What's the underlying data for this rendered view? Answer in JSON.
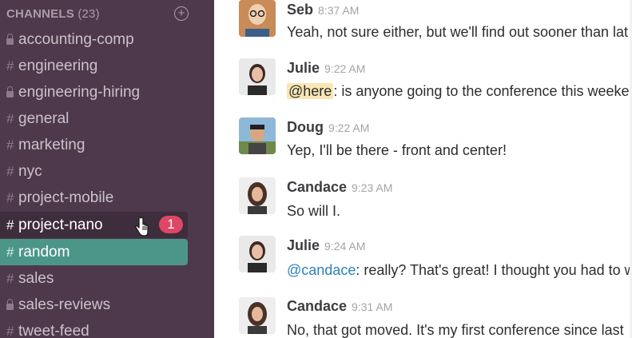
{
  "sidebar": {
    "header": {
      "title": "CHANNELS",
      "count": "(23)",
      "add_symbol": "+"
    },
    "channels": [
      {
        "name": "accounting-comp",
        "prefix": "lock-icon",
        "state": "normal"
      },
      {
        "name": "engineering",
        "prefix": "#",
        "state": "normal"
      },
      {
        "name": "engineering-hiring",
        "prefix": "lock-icon",
        "state": "normal"
      },
      {
        "name": "general",
        "prefix": "#",
        "state": "normal"
      },
      {
        "name": "marketing",
        "prefix": "#",
        "state": "normal"
      },
      {
        "name": "nyc",
        "prefix": "#",
        "state": "normal"
      },
      {
        "name": "project-mobile",
        "prefix": "#",
        "state": "normal"
      },
      {
        "name": "project-nano",
        "prefix": "#",
        "state": "unread",
        "badge": "1"
      },
      {
        "name": "random",
        "prefix": "#",
        "state": "active"
      },
      {
        "name": "sales",
        "prefix": "#",
        "state": "normal"
      },
      {
        "name": "sales-reviews",
        "prefix": "lock-icon",
        "state": "normal"
      },
      {
        "name": "tweet-feed",
        "prefix": "#",
        "state": "normal"
      }
    ]
  },
  "messages": [
    {
      "author": "Seb",
      "time": "8:37 AM",
      "text": "Yeah, not sure either, but we'll find out sooner than lat"
    },
    {
      "author": "Julie",
      "time": "9:22 AM",
      "mention": "@here",
      "text": ": is anyone going to the conference this weeken"
    },
    {
      "author": "Doug",
      "time": "9:22 AM",
      "text": "Yep, I'll be there - front and center!"
    },
    {
      "author": "Candace",
      "time": "9:23 AM",
      "text": "So will I."
    },
    {
      "author": "Julie",
      "time": "9:24 AM",
      "mention": "@candace",
      "text": ": really? That's great! I thought you had to w"
    },
    {
      "author": "Candace",
      "time": "9:31 AM",
      "text": "No, that got moved. It's my first conference since last"
    }
  ],
  "colors": {
    "sidebar_bg": "#4d394b",
    "active_channel": "#4c9689",
    "badge": "#de4766",
    "mention_here_bg": "#f8e7b3",
    "mention_link": "#2a80b9"
  }
}
